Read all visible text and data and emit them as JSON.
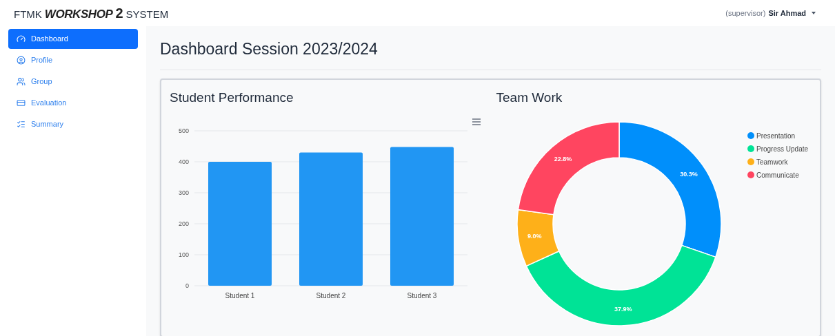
{
  "brand": {
    "prefix": "FTMK",
    "main": "WORKSHOP",
    "number": "2",
    "suffix": "SYSTEM"
  },
  "user": {
    "role": "(supervisor)",
    "name": "Sir Ahmad"
  },
  "sidebar": {
    "items": [
      {
        "label": "Dashboard",
        "selected": true
      },
      {
        "label": "Profile",
        "selected": false
      },
      {
        "label": "Group",
        "selected": false
      },
      {
        "label": "Evaluation",
        "selected": false
      },
      {
        "label": "Summary",
        "selected": false
      }
    ]
  },
  "page_title": "Dashboard Session 2023/2024",
  "panels": [
    {
      "title": "Student Performance",
      "chart_data": {
        "type": "bar",
        "categories": [
          "Student 1",
          "Student 2",
          "Student 3"
        ],
        "values": [
          400,
          430,
          448
        ],
        "ylim": [
          0,
          500
        ],
        "yticks": [
          0,
          100,
          200,
          300,
          400,
          500
        ],
        "grid": true
      }
    },
    {
      "title": "Team Work",
      "chart_data": {
        "type": "donut",
        "categories": [
          "Presentation",
          "Progress Update",
          "Teamwork",
          "Communicate"
        ],
        "values": [
          30.3,
          37.9,
          9.0,
          22.8
        ],
        "colors": [
          "#008ffb",
          "#00e396",
          "#feb019",
          "#ff4560"
        ],
        "value_labels": [
          "30.3%",
          "37.9%",
          "9.0%",
          "22.8%"
        ],
        "legend": "right"
      }
    }
  ]
}
